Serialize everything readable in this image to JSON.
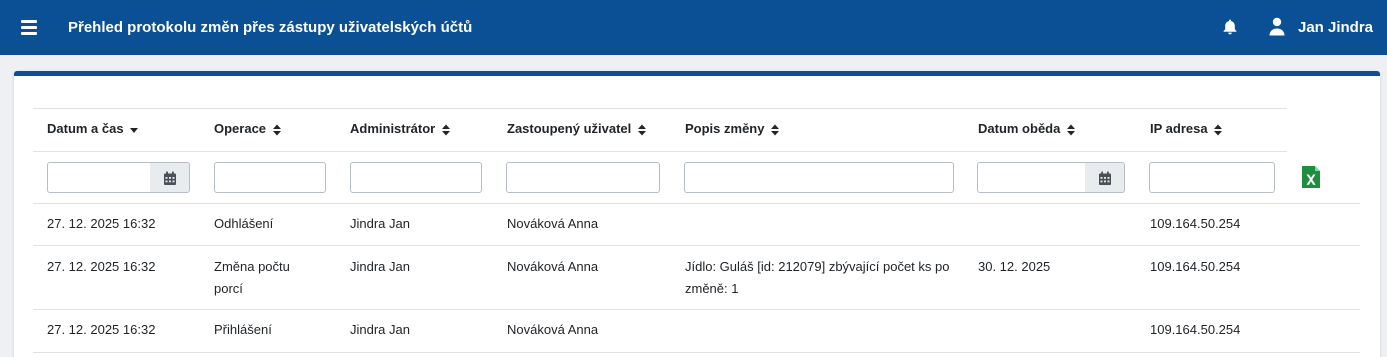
{
  "header": {
    "title": "Přehled protokolu změn přes zástupy uživatelských účtů",
    "user_name": "Jan Jindra"
  },
  "table": {
    "columns": [
      {
        "label": "Datum a čas",
        "sort": "desc"
      },
      {
        "label": "Operace",
        "sort": "none"
      },
      {
        "label": "Administrátor",
        "sort": "none"
      },
      {
        "label": "Zastoupený uživatel",
        "sort": "none"
      },
      {
        "label": "Popis změny",
        "sort": "none"
      },
      {
        "label": "Datum oběda",
        "sort": "none"
      },
      {
        "label": "IP adresa",
        "sort": "none"
      }
    ],
    "filters": {
      "datum_cas": "",
      "operace": "",
      "administrator": "",
      "zastoupeny": "",
      "popis": "",
      "datum_obeda": "",
      "ip": ""
    },
    "rows": [
      {
        "datum_cas": "27. 12. 2025 16:32",
        "operace": "Odhlášení",
        "administrator": "Jindra Jan",
        "zastoupeny": "Nováková Anna",
        "popis_line1": "",
        "popis_line2": "",
        "datum_obeda": "",
        "ip": "109.164.50.254"
      },
      {
        "datum_cas": "27. 12. 2025 16:32",
        "operace_line1": "Změna počtu",
        "operace_line2": "porcí",
        "administrator": "Jindra Jan",
        "zastoupeny": "Nováková Anna",
        "popis_line1": "Jídlo: Guláš [id: 212079] zbývající počet ks po",
        "popis_line2": "změně: 1",
        "datum_obeda": "30. 12. 2025",
        "ip": "109.164.50.254"
      },
      {
        "datum_cas": "27. 12. 2025 16:32",
        "operace": "Přihlášení",
        "administrator": "Jindra Jan",
        "zastoupeny": "Nováková Anna",
        "popis_line1": "",
        "popis_line2": "",
        "datum_obeda": "",
        "ip": "109.164.50.254"
      }
    ]
  },
  "icons": {
    "menu": "hamburger-icon",
    "notifications": "bell-icon",
    "user": "user-icon",
    "calendar": "calendar-icon",
    "export": "excel-export-icon",
    "sort_desc": "caret-down-icon",
    "sort_both": "sort-icon"
  },
  "colors": {
    "brand": "#0b4f94",
    "excel": "#1e8e3e"
  }
}
